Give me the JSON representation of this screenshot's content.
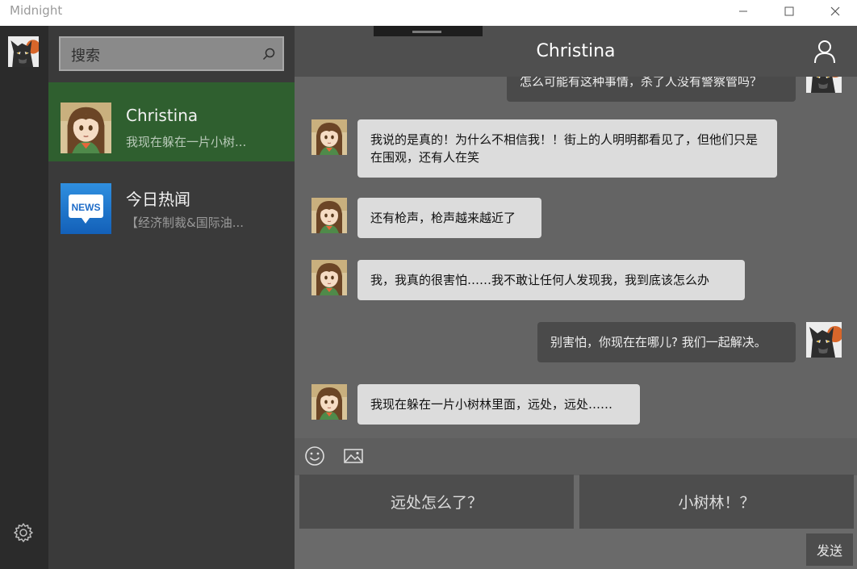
{
  "window": {
    "title": "Midnight"
  },
  "sidebar": {
    "search_placeholder": "搜索"
  },
  "contacts": [
    {
      "name": "Christina",
      "preview": "我现在躲在一片小树..."
    },
    {
      "name": "今日热闻",
      "preview": "【经济制裁&国际油...",
      "icon_text": "NEWS"
    }
  ],
  "chat": {
    "title": "Christina",
    "messages": [
      {
        "from": "me",
        "text": "怎么可能有这种事情，杀了人没有警察管吗？"
      },
      {
        "from": "them",
        "text": "我说的是真的！为什么不相信我！！街上的人明明都看见了，但他们只是在围观，还有人在笑"
      },
      {
        "from": "them",
        "text": "还有枪声，枪声越来越近了"
      },
      {
        "from": "them",
        "text": "我，我真的很害怕……我不敢让任何人发现我，我到底该怎么办"
      },
      {
        "from": "me",
        "text": "别害怕，你现在在哪儿? 我们一起解决。"
      },
      {
        "from": "them",
        "text": "我现在躲在一片小树林里面，远处，远处……"
      }
    ],
    "quick_replies": [
      "远处怎么了？",
      "小树林！？"
    ],
    "send_label": "发送"
  },
  "colors": {
    "active_contact": "#2f5f2f",
    "rail": "#2b2b2b",
    "list": "#3a3a3a",
    "chat_bg": "#686868"
  },
  "icons": [
    "minimize-icon",
    "maximize-icon",
    "close-icon",
    "search-icon",
    "settings-gear-icon",
    "profile-icon",
    "emoji-icon",
    "image-icon"
  ]
}
